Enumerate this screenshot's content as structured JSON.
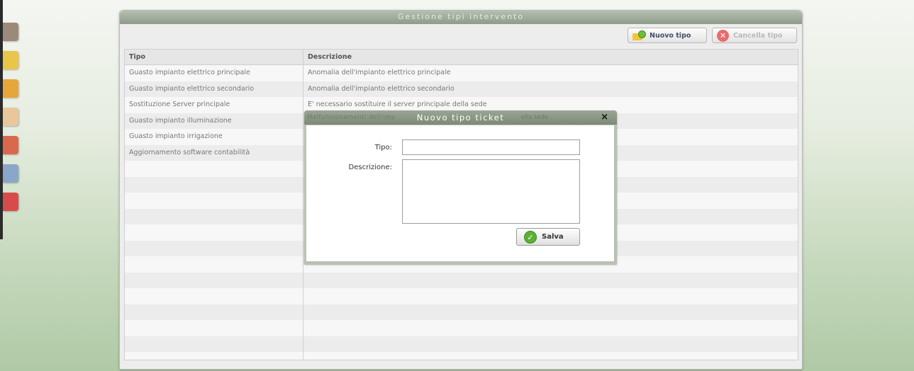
{
  "window": {
    "title": "Gestione tipi intervento"
  },
  "toolbar": {
    "new_label": "Nuovo tipo",
    "delete_label": "Cancella tipo"
  },
  "grid": {
    "columns": [
      "Tipo",
      "Descrizione"
    ],
    "rows": [
      [
        "Guasto impianto elettrico principale",
        "Anomalia dell'impianto elettrico principale"
      ],
      [
        "Guasto impianto elettrico secondario",
        "Anomalia dell'impianto elettrico secondario"
      ],
      [
        "Sostituzione Server principale",
        "E' necessario sostituire il server principale della sede"
      ],
      [
        "Guasto impianto illuminazione",
        ""
      ],
      [
        "Guasto impianto irrigazione",
        ""
      ],
      [
        "Aggiornamento software contabilità",
        ""
      ]
    ]
  },
  "dialog": {
    "title": "Nuovo tipo ticket",
    "ghost_left": "Malfunzionamenti dell'imp",
    "ghost_right": "ella sede",
    "tipo_label": "Tipo:",
    "tipo_value": "",
    "descr_label": "Descrizione:",
    "descr_value": "",
    "save_label": "Salva",
    "close_symbol": "×"
  },
  "launcher": {
    "icons": [
      {
        "name": "box-icon",
        "color": "#9b8a7a"
      },
      {
        "name": "pencil-icon",
        "color": "#e8c64a"
      },
      {
        "name": "tree-icon",
        "color": "#e7a63b"
      },
      {
        "name": "package-icon",
        "color": "#e9c79b"
      },
      {
        "name": "chart-icon",
        "color": "#d9694c"
      },
      {
        "name": "user-info-icon",
        "color": "#8aa6c9"
      },
      {
        "name": "power-icon",
        "color": "#d84b4b"
      }
    ]
  }
}
